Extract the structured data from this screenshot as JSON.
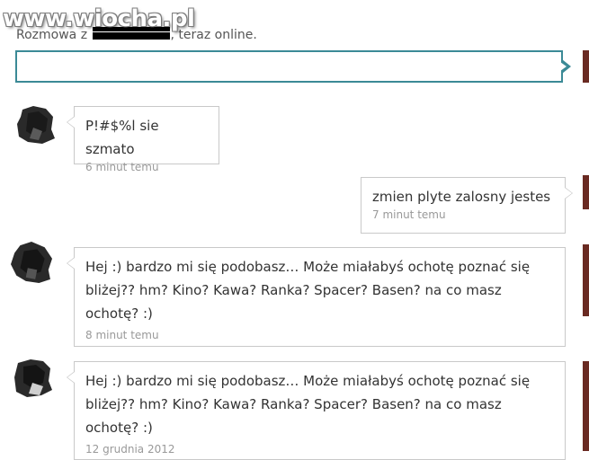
{
  "watermark": "www.wiocha.pl",
  "header": {
    "prefix": "Rozmowa z",
    "suffix": ", teraz online."
  },
  "reply_input": {
    "value": "",
    "placeholder": ""
  },
  "messages": [
    {
      "side": "left",
      "text": "P!#$%l sie szmato",
      "time": "6 minut temu"
    },
    {
      "side": "right",
      "text": "zmien plyte zalosny jestes",
      "time": "7 minut temu"
    },
    {
      "side": "left",
      "text": "Hej :) bardzo mi się podobasz… Może miałabyś ochotę poznać się bliżej?? hm? Kino? Kawa? Ranka? Spacer? Basen? na co masz ochotę? :)",
      "time": "8 minut temu"
    },
    {
      "side": "left",
      "text": "Hej :) bardzo mi się podobasz… Może miałabyś ochotę poznać się bliżej?? hm? Kino? Kawa? Ranka? Spacer? Basen? na co masz ochotę? :)",
      "time": "12 grudnia 2012"
    }
  ],
  "colors": {
    "accent": "#3b8a96",
    "bubble_border": "#c9c9c9",
    "time_text": "#999999"
  }
}
